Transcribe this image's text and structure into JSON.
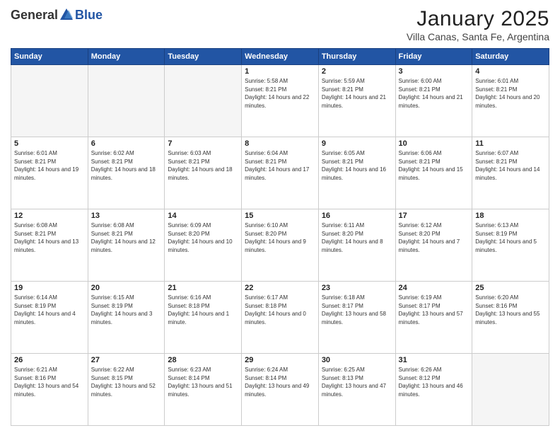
{
  "logo": {
    "general": "General",
    "blue": "Blue"
  },
  "header": {
    "month": "January 2025",
    "location": "Villa Canas, Santa Fe, Argentina"
  },
  "weekdays": [
    "Sunday",
    "Monday",
    "Tuesday",
    "Wednesday",
    "Thursday",
    "Friday",
    "Saturday"
  ],
  "weeks": [
    [
      {
        "day": "",
        "sunrise": "",
        "sunset": "",
        "daylight": ""
      },
      {
        "day": "",
        "sunrise": "",
        "sunset": "",
        "daylight": ""
      },
      {
        "day": "",
        "sunrise": "",
        "sunset": "",
        "daylight": ""
      },
      {
        "day": "1",
        "sunrise": "Sunrise: 5:58 AM",
        "sunset": "Sunset: 8:21 PM",
        "daylight": "Daylight: 14 hours and 22 minutes."
      },
      {
        "day": "2",
        "sunrise": "Sunrise: 5:59 AM",
        "sunset": "Sunset: 8:21 PM",
        "daylight": "Daylight: 14 hours and 21 minutes."
      },
      {
        "day": "3",
        "sunrise": "Sunrise: 6:00 AM",
        "sunset": "Sunset: 8:21 PM",
        "daylight": "Daylight: 14 hours and 21 minutes."
      },
      {
        "day": "4",
        "sunrise": "Sunrise: 6:01 AM",
        "sunset": "Sunset: 8:21 PM",
        "daylight": "Daylight: 14 hours and 20 minutes."
      }
    ],
    [
      {
        "day": "5",
        "sunrise": "Sunrise: 6:01 AM",
        "sunset": "Sunset: 8:21 PM",
        "daylight": "Daylight: 14 hours and 19 minutes."
      },
      {
        "day": "6",
        "sunrise": "Sunrise: 6:02 AM",
        "sunset": "Sunset: 8:21 PM",
        "daylight": "Daylight: 14 hours and 18 minutes."
      },
      {
        "day": "7",
        "sunrise": "Sunrise: 6:03 AM",
        "sunset": "Sunset: 8:21 PM",
        "daylight": "Daylight: 14 hours and 18 minutes."
      },
      {
        "day": "8",
        "sunrise": "Sunrise: 6:04 AM",
        "sunset": "Sunset: 8:21 PM",
        "daylight": "Daylight: 14 hours and 17 minutes."
      },
      {
        "day": "9",
        "sunrise": "Sunrise: 6:05 AM",
        "sunset": "Sunset: 8:21 PM",
        "daylight": "Daylight: 14 hours and 16 minutes."
      },
      {
        "day": "10",
        "sunrise": "Sunrise: 6:06 AM",
        "sunset": "Sunset: 8:21 PM",
        "daylight": "Daylight: 14 hours and 15 minutes."
      },
      {
        "day": "11",
        "sunrise": "Sunrise: 6:07 AM",
        "sunset": "Sunset: 8:21 PM",
        "daylight": "Daylight: 14 hours and 14 minutes."
      }
    ],
    [
      {
        "day": "12",
        "sunrise": "Sunrise: 6:08 AM",
        "sunset": "Sunset: 8:21 PM",
        "daylight": "Daylight: 14 hours and 13 minutes."
      },
      {
        "day": "13",
        "sunrise": "Sunrise: 6:08 AM",
        "sunset": "Sunset: 8:21 PM",
        "daylight": "Daylight: 14 hours and 12 minutes."
      },
      {
        "day": "14",
        "sunrise": "Sunrise: 6:09 AM",
        "sunset": "Sunset: 8:20 PM",
        "daylight": "Daylight: 14 hours and 10 minutes."
      },
      {
        "day": "15",
        "sunrise": "Sunrise: 6:10 AM",
        "sunset": "Sunset: 8:20 PM",
        "daylight": "Daylight: 14 hours and 9 minutes."
      },
      {
        "day": "16",
        "sunrise": "Sunrise: 6:11 AM",
        "sunset": "Sunset: 8:20 PM",
        "daylight": "Daylight: 14 hours and 8 minutes."
      },
      {
        "day": "17",
        "sunrise": "Sunrise: 6:12 AM",
        "sunset": "Sunset: 8:20 PM",
        "daylight": "Daylight: 14 hours and 7 minutes."
      },
      {
        "day": "18",
        "sunrise": "Sunrise: 6:13 AM",
        "sunset": "Sunset: 8:19 PM",
        "daylight": "Daylight: 14 hours and 5 minutes."
      }
    ],
    [
      {
        "day": "19",
        "sunrise": "Sunrise: 6:14 AM",
        "sunset": "Sunset: 8:19 PM",
        "daylight": "Daylight: 14 hours and 4 minutes."
      },
      {
        "day": "20",
        "sunrise": "Sunrise: 6:15 AM",
        "sunset": "Sunset: 8:19 PM",
        "daylight": "Daylight: 14 hours and 3 minutes."
      },
      {
        "day": "21",
        "sunrise": "Sunrise: 6:16 AM",
        "sunset": "Sunset: 8:18 PM",
        "daylight": "Daylight: 14 hours and 1 minute."
      },
      {
        "day": "22",
        "sunrise": "Sunrise: 6:17 AM",
        "sunset": "Sunset: 8:18 PM",
        "daylight": "Daylight: 14 hours and 0 minutes."
      },
      {
        "day": "23",
        "sunrise": "Sunrise: 6:18 AM",
        "sunset": "Sunset: 8:17 PM",
        "daylight": "Daylight: 13 hours and 58 minutes."
      },
      {
        "day": "24",
        "sunrise": "Sunrise: 6:19 AM",
        "sunset": "Sunset: 8:17 PM",
        "daylight": "Daylight: 13 hours and 57 minutes."
      },
      {
        "day": "25",
        "sunrise": "Sunrise: 6:20 AM",
        "sunset": "Sunset: 8:16 PM",
        "daylight": "Daylight: 13 hours and 55 minutes."
      }
    ],
    [
      {
        "day": "26",
        "sunrise": "Sunrise: 6:21 AM",
        "sunset": "Sunset: 8:16 PM",
        "daylight": "Daylight: 13 hours and 54 minutes."
      },
      {
        "day": "27",
        "sunrise": "Sunrise: 6:22 AM",
        "sunset": "Sunset: 8:15 PM",
        "daylight": "Daylight: 13 hours and 52 minutes."
      },
      {
        "day": "28",
        "sunrise": "Sunrise: 6:23 AM",
        "sunset": "Sunset: 8:14 PM",
        "daylight": "Daylight: 13 hours and 51 minutes."
      },
      {
        "day": "29",
        "sunrise": "Sunrise: 6:24 AM",
        "sunset": "Sunset: 8:14 PM",
        "daylight": "Daylight: 13 hours and 49 minutes."
      },
      {
        "day": "30",
        "sunrise": "Sunrise: 6:25 AM",
        "sunset": "Sunset: 8:13 PM",
        "daylight": "Daylight: 13 hours and 47 minutes."
      },
      {
        "day": "31",
        "sunrise": "Sunrise: 6:26 AM",
        "sunset": "Sunset: 8:12 PM",
        "daylight": "Daylight: 13 hours and 46 minutes."
      },
      {
        "day": "",
        "sunrise": "",
        "sunset": "",
        "daylight": ""
      }
    ]
  ]
}
